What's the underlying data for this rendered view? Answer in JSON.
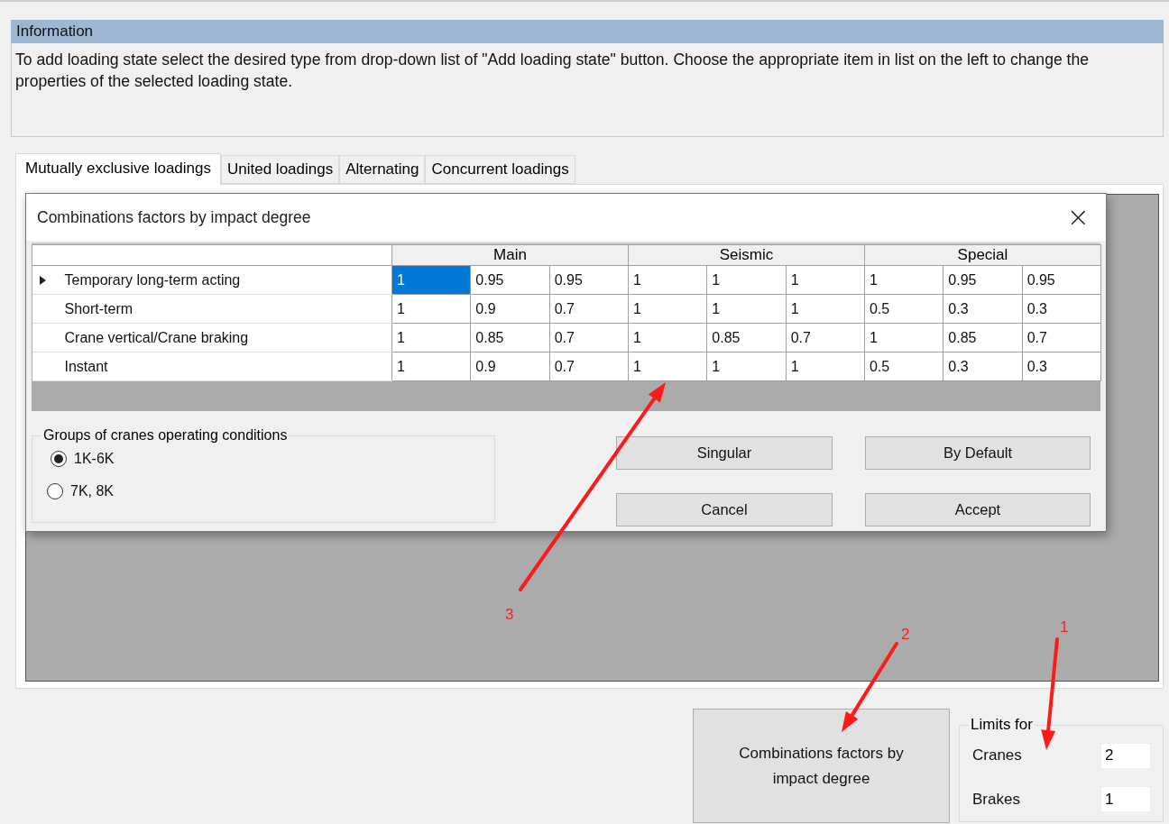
{
  "info": {
    "title": "Information",
    "text": "To add loading state select the desired type from drop-down list of \"Add loading state\" button. Choose the appropriate item in list on the left to change the properties of the selected loading state."
  },
  "tabs": [
    {
      "label": "Mutually exclusive loadings",
      "selected": true
    },
    {
      "label": "United loadings",
      "selected": false
    },
    {
      "label": "Alternating",
      "selected": false
    },
    {
      "label": "Concurrent loadings",
      "selected": false
    }
  ],
  "dialog": {
    "title": "Combinations factors by impact degree",
    "close": "×",
    "groups": [
      "Main",
      "Seismic",
      "Special"
    ],
    "rows": [
      {
        "label": "Temporary long-term acting",
        "current": true,
        "cells": [
          {
            "value": "1",
            "selected": true
          },
          {
            "value": "0.95",
            "selected": false
          },
          {
            "value": "0.95",
            "selected": false
          },
          {
            "value": "1",
            "selected": false
          },
          {
            "value": "1",
            "selected": false
          },
          {
            "value": "1",
            "selected": false
          },
          {
            "value": "1",
            "selected": false
          },
          {
            "value": "0.95",
            "selected": false
          },
          {
            "value": "0.95",
            "selected": false
          }
        ]
      },
      {
        "label": "Short-term",
        "current": false,
        "cells": [
          {
            "value": "1",
            "selected": false
          },
          {
            "value": "0.9",
            "selected": false
          },
          {
            "value": "0.7",
            "selected": false
          },
          {
            "value": "1",
            "selected": false
          },
          {
            "value": "1",
            "selected": false
          },
          {
            "value": "1",
            "selected": false
          },
          {
            "value": "0.5",
            "selected": false
          },
          {
            "value": "0.3",
            "selected": false
          },
          {
            "value": "0.3",
            "selected": false
          }
        ]
      },
      {
        "label": "Crane vertical/Crane braking",
        "current": false,
        "cells": [
          {
            "value": "1",
            "selected": false
          },
          {
            "value": "0.85",
            "selected": false
          },
          {
            "value": "0.7",
            "selected": false
          },
          {
            "value": "1",
            "selected": false
          },
          {
            "value": "0.85",
            "selected": false
          },
          {
            "value": "0.7",
            "selected": false
          },
          {
            "value": "1",
            "selected": false
          },
          {
            "value": "0.85",
            "selected": false
          },
          {
            "value": "0.7",
            "selected": false
          }
        ]
      },
      {
        "label": "Instant",
        "current": false,
        "cells": [
          {
            "value": "1",
            "selected": false
          },
          {
            "value": "0.9",
            "selected": false
          },
          {
            "value": "0.7",
            "selected": false
          },
          {
            "value": "1",
            "selected": false
          },
          {
            "value": "1",
            "selected": false
          },
          {
            "value": "1",
            "selected": false
          },
          {
            "value": "0.5",
            "selected": false
          },
          {
            "value": "0.3",
            "selected": false
          },
          {
            "value": "0.3",
            "selected": false
          }
        ]
      }
    ],
    "cranes_group": {
      "title": "Groups of cranes operating conditions",
      "options": [
        {
          "label": "1K-6K",
          "selected": true
        },
        {
          "label": "7K, 8K",
          "selected": false
        }
      ]
    },
    "buttons": [
      "Singular",
      "By Default",
      "Cancel",
      "Accept"
    ]
  },
  "combinations_button": "Combinations factors by impact degree",
  "limits": {
    "title": "Limits for",
    "fields": [
      {
        "label": "Cranes",
        "value": "2"
      },
      {
        "label": "Brakes",
        "value": "1"
      }
    ]
  },
  "annotations": [
    "3",
    "2",
    "1"
  ]
}
